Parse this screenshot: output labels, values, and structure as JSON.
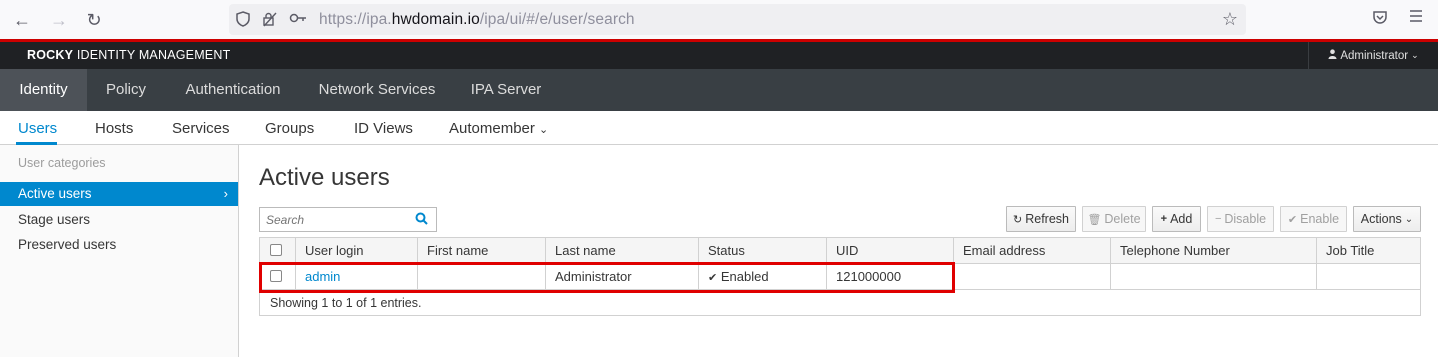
{
  "browser": {
    "url_prefix": "https://ipa.",
    "url_domain": "hwdomain.io",
    "url_path": "/ipa/ui/#/e/user/search"
  },
  "masthead": {
    "brand_bold": "ROCKY",
    "brand_rest": " IDENTITY MANAGEMENT",
    "user": "Administrator"
  },
  "primary_nav": [
    "Identity",
    "Policy",
    "Authentication",
    "Network Services",
    "IPA Server"
  ],
  "secondary_nav": [
    "Users",
    "Hosts",
    "Services",
    "Groups",
    "ID Views",
    "Automember"
  ],
  "sidebar": {
    "heading": "User categories",
    "items": [
      "Active users",
      "Stage users",
      "Preserved users"
    ]
  },
  "main": {
    "title": "Active users",
    "search_placeholder": "Search",
    "buttons": {
      "refresh": "Refresh",
      "delete": "Delete",
      "add": "Add",
      "disable": "Disable",
      "enable": "Enable",
      "actions": "Actions"
    },
    "columns": [
      "User login",
      "First name",
      "Last name",
      "Status",
      "UID",
      "Email address",
      "Telephone Number",
      "Job Title"
    ],
    "rows": [
      {
        "login": "admin",
        "first_name": "",
        "last_name": "Administrator",
        "status": "Enabled",
        "uid": "121000000",
        "email": "",
        "phone": "",
        "job_title": ""
      }
    ],
    "footer": "Showing 1 to 1 of 1 entries."
  },
  "colors": {
    "accent": "#0088ce",
    "masthead": "#1f2124",
    "primary_nav": "#393f44",
    "highlight": "#e00000"
  }
}
